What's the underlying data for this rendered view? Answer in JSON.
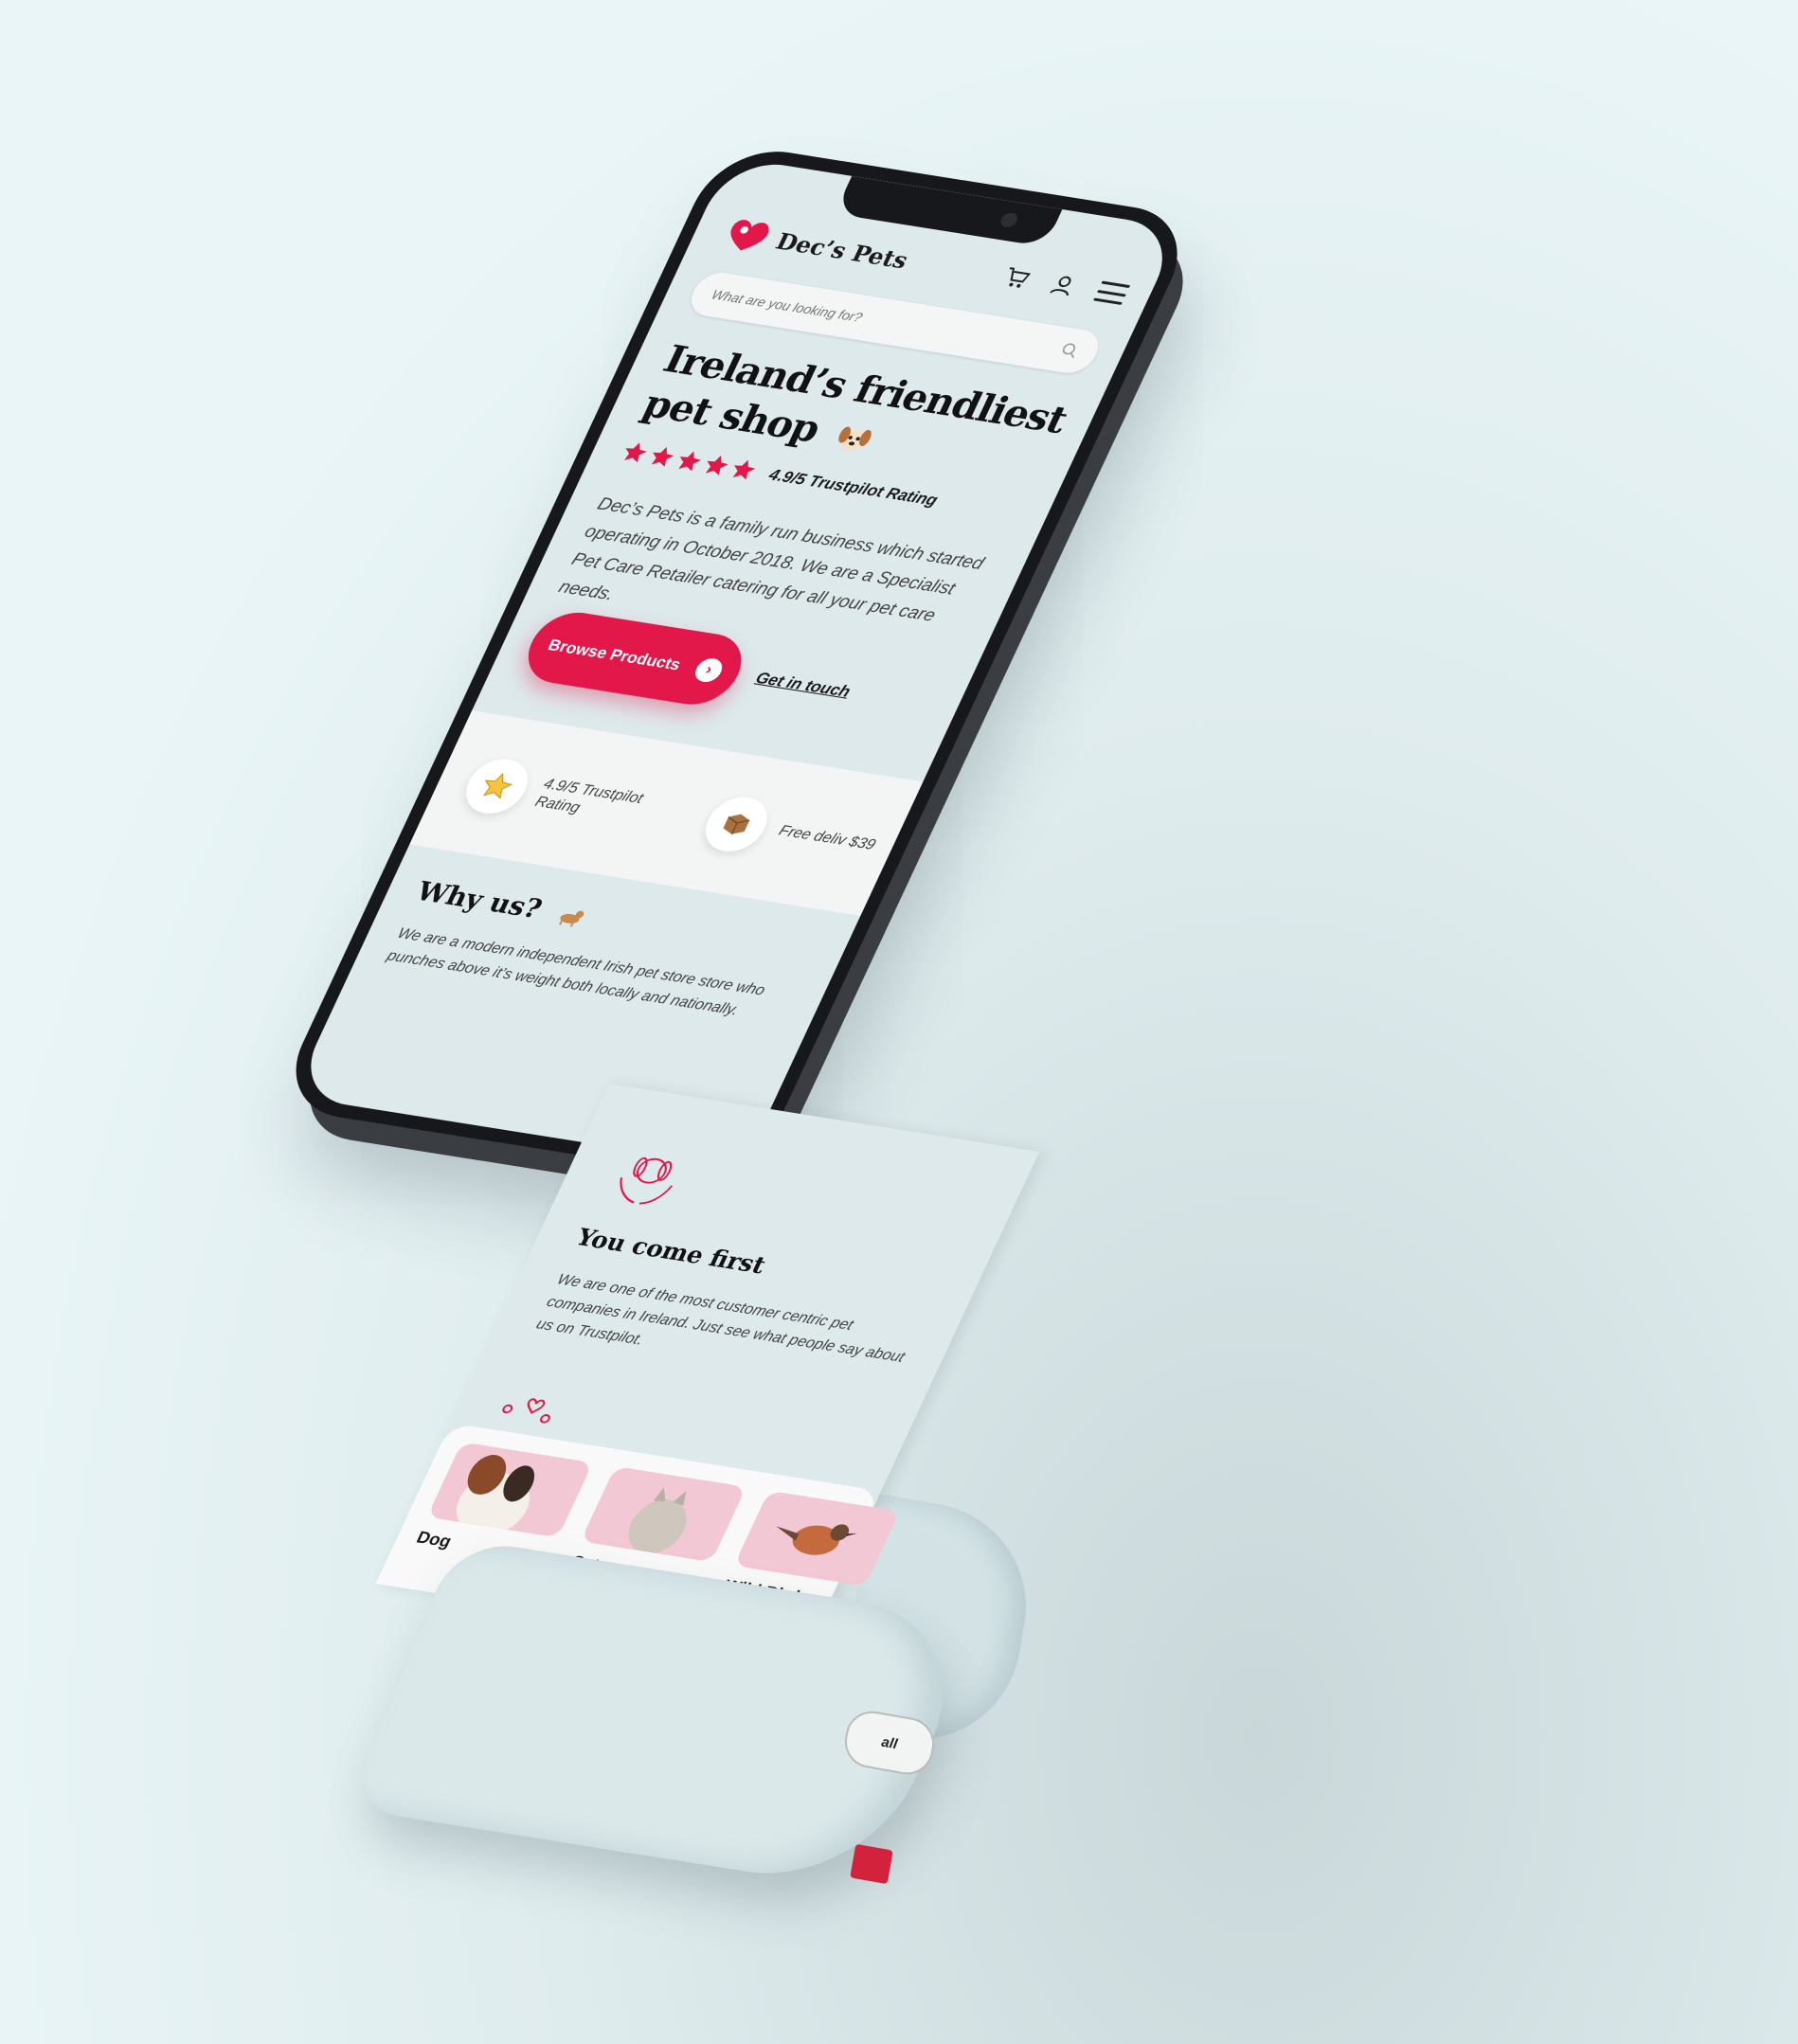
{
  "header": {
    "brand": "Dec’s Pets",
    "cart_icon": "cart-icon",
    "account_icon": "user-icon",
    "menu_icon": "hamburger-icon"
  },
  "search": {
    "placeholder": "What are you looking for?",
    "icon": "search-icon"
  },
  "hero": {
    "title_line1": "Ireland’s friendliest",
    "title_line2": "pet shop",
    "emoji": "dog-face-emoji",
    "rating_text": "4.9/5 Trustpilot Rating",
    "stars": 5,
    "intro": "Dec’s Pets is a family run business which started operating in October 2018. We are a Specialist Pet Care Retailer catering for all your pet care needs.",
    "primary_cta": "Browse Products",
    "secondary_cta": "Get in touch"
  },
  "usps": [
    {
      "icon": "star-icon",
      "text": "4.9/5 Trustpilot Rating"
    },
    {
      "icon": "box-icon",
      "text": "Free deliv $39"
    }
  ],
  "why_us": {
    "title": "Why us?",
    "emoji": "dog-emoji",
    "text": "We are a modern independent Irish pet store store who punches above it’s weight both locally and nationally."
  },
  "you_come_first": {
    "icon": "pet-care-hands-icon",
    "title": "You come first",
    "text": "We are one of the most customer centric pet companies in Ireland. Just see what people say about us on Trustpilot."
  },
  "categories": [
    {
      "label": "Dog"
    },
    {
      "label": "Cat"
    },
    {
      "label": "Wild Bird"
    }
  ],
  "see_all": "all",
  "colors": {
    "accent": "#e3184a",
    "background": "#dde9eb",
    "text": "#121212"
  }
}
